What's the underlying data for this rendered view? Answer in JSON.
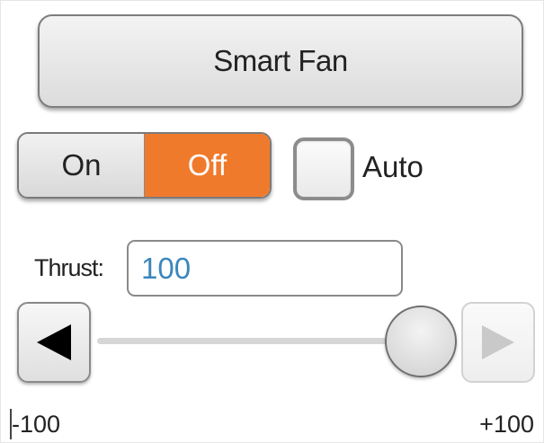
{
  "title_button": {
    "label": "Smart Fan"
  },
  "power_toggle": {
    "on_label": "On",
    "off_label": "Off",
    "selected": "Off",
    "accent_color": "#f07a2c"
  },
  "auto_checkbox": {
    "label": "Auto",
    "checked": false
  },
  "thrust": {
    "label": "Thrust:",
    "value": "100",
    "value_color": "#3a86bd"
  },
  "slider": {
    "min": -100,
    "max": 100,
    "value": 100,
    "min_label": "-100",
    "max_label": "+100",
    "decrement_icon": "triangle-left-icon",
    "increment_icon": "triangle-right-icon",
    "increment_enabled": false
  }
}
